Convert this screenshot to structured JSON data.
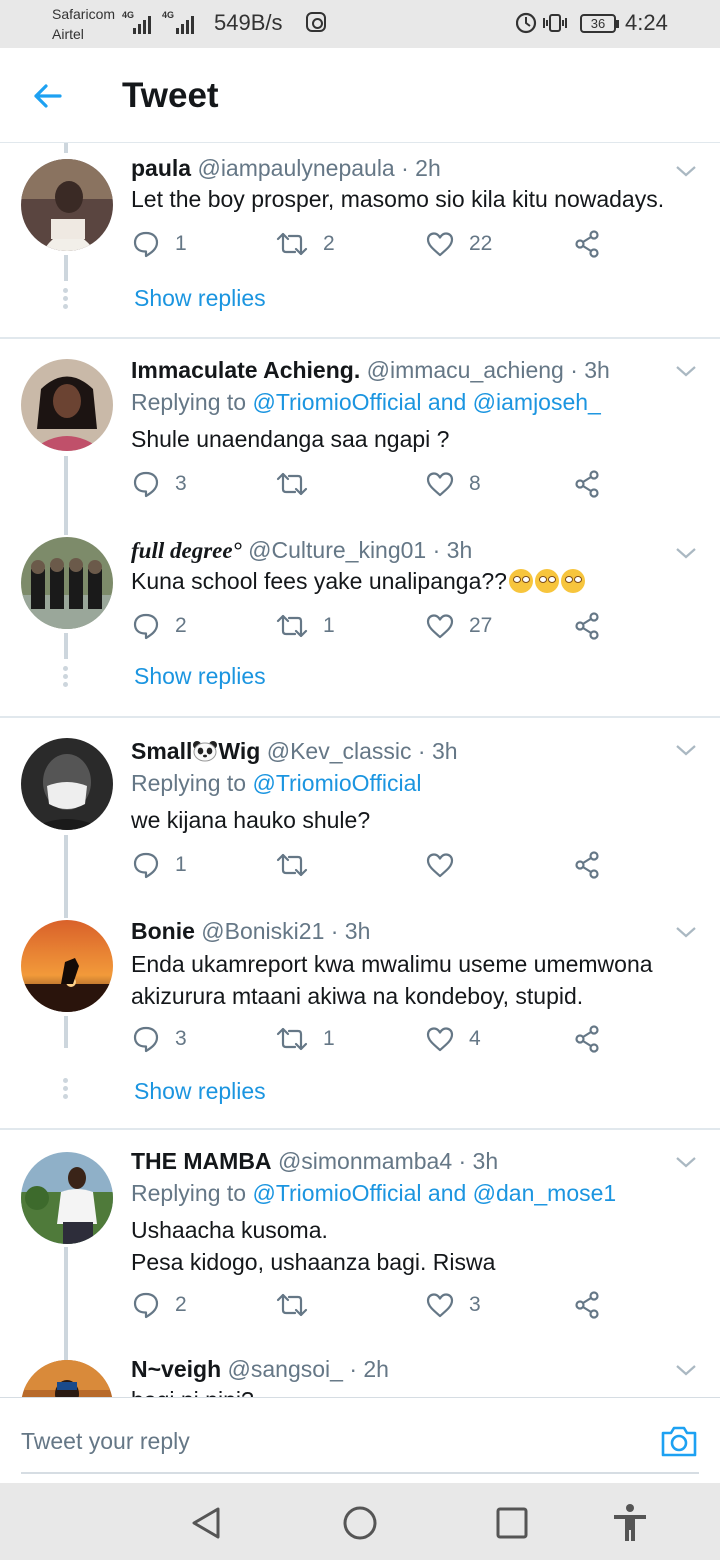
{
  "status_bar": {
    "carrier_1": "Safaricom",
    "carrier_2": "Airtel",
    "sig1_label": "4G",
    "sig2_label": "4G",
    "net_speed": "549B/s",
    "battery": "36",
    "time": "4:24"
  },
  "header": {
    "title": "Tweet"
  },
  "tweets": [
    {
      "name": "paula",
      "handle": "@iampaulynepaula · 2h",
      "text": "Let the boy prosper, masomo sio kila kitu nowadays.",
      "replies": "1",
      "retweets": "2",
      "likes": "22"
    },
    {
      "name": "Immaculate Achieng.",
      "handle": "@immacu_achieng · 3h",
      "reply_prefix": "Replying to ",
      "mentions": "@TriomioOfficial and @iamjoseh_",
      "text": "Shule unaendanga saa ngapi ?",
      "replies": "3",
      "retweets": "",
      "likes": "8"
    },
    {
      "name": "full degree°",
      "handle": "@Culture_king01 · 3h",
      "text": "Kuna school fees yake unalipanga??",
      "replies": "2",
      "retweets": "1",
      "likes": "27"
    },
    {
      "name_part1": "Small",
      "name_part2": "Wig",
      "handle": "@Kev_classic · 3h",
      "reply_prefix": "Replying to ",
      "mentions": "@TriomioOfficial",
      "text": "we kijana hauko shule?",
      "replies": "1",
      "retweets": "",
      "likes": ""
    },
    {
      "name": "Bonie",
      "handle": "@Boniski21 · 3h",
      "text_line1": "Enda ukamreport kwa mwalimu useme umemwona",
      "text_line2": "akizurura mtaani akiwa na kondeboy, stupid.",
      "replies": "3",
      "retweets": "1",
      "likes": "4"
    },
    {
      "name": "THE MAMBA",
      "handle": "@simonmamba4 · 3h",
      "reply_prefix": "Replying to ",
      "mentions": "@TriomioOfficial and @dan_mose1",
      "text_line1": "Ushaacha kusoma.",
      "text_line2": "Pesa kidogo, ushaanza bagi. Riswa",
      "replies": "2",
      "retweets": "",
      "likes": "3"
    },
    {
      "name": "N~veigh",
      "handle": "@sangsoi_ · 2h",
      "text": "bagi ni nini?"
    }
  ],
  "show_replies": "Show replies",
  "reply_bar": {
    "placeholder": "Tweet your reply"
  },
  "colors": {
    "accent": "#1b95e0",
    "secondary_text": "#657786",
    "divider": "#e1e8ed"
  }
}
